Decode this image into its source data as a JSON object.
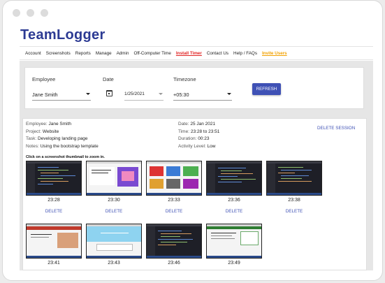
{
  "app": {
    "logo": "TeamLogger"
  },
  "nav": {
    "items": [
      "Account",
      "Screenshots",
      "Reports",
      "Manage",
      "Admin",
      "Off-Computer Time"
    ],
    "install_timer": "Install Timer",
    "contact": "Contact Us",
    "help": "Help / FAQs",
    "invite": "Invite Users"
  },
  "filters": {
    "employee_label": "Employee",
    "employee_value": "Jane Smith",
    "date_label": "Date",
    "date_value": "1/25/2021",
    "timezone_label": "Timezone",
    "timezone_value": "+05:30",
    "refresh_label": "REFRESH"
  },
  "session": {
    "employee_key": "Employee:",
    "employee_value": "Jane Smith",
    "project_key": "Project:",
    "project_value": "Website",
    "task_key": "Task:",
    "task_value": "Developing landing page",
    "notes_key": "Notes:",
    "notes_value": "Using the bootstrap template",
    "date_key": "Date:",
    "date_value": "25 Jan 2021",
    "time_key": "Time:",
    "time_value": "23:28 to 23:51",
    "duration_key": "Duration:",
    "duration_value": "00:23",
    "activity_key": "Activity Level:",
    "activity_value": "Low",
    "delete_session": "DELETE SESSION",
    "hint": "Click on a screenshot thumbnail to zoom in."
  },
  "screenshots": [
    {
      "time": "23:28",
      "delete": "DELETE",
      "theme": "dark"
    },
    {
      "time": "23:30",
      "delete": "DELETE",
      "theme": "light"
    },
    {
      "time": "23:33",
      "delete": "DELETE",
      "theme": "light"
    },
    {
      "time": "23:36",
      "delete": "DELETE",
      "theme": "dark"
    },
    {
      "time": "23:38",
      "delete": "DELETE",
      "theme": "dark"
    },
    {
      "time": "23:41",
      "theme": "light"
    },
    {
      "time": "23:43",
      "theme": "light"
    },
    {
      "time": "23:46",
      "theme": "dark"
    },
    {
      "time": "23:49",
      "theme": "light"
    }
  ],
  "colors": {
    "brand": "#2c3a93",
    "accent": "#3f51b5",
    "install": "#e02424",
    "invite": "#f2a100"
  }
}
